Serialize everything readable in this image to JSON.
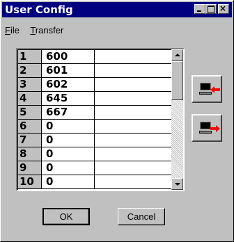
{
  "window": {
    "title": "User Config"
  },
  "menu": [
    {
      "label": "File",
      "underline": "F",
      "rest": "ile"
    },
    {
      "label": "Transfer",
      "underline": "T",
      "rest": "ransfer"
    }
  ],
  "table": {
    "rows": [
      {
        "index": "1",
        "value": "600"
      },
      {
        "index": "2",
        "value": "601"
      },
      {
        "index": "3",
        "value": "602"
      },
      {
        "index": "4",
        "value": "645"
      },
      {
        "index": "5",
        "value": "667"
      },
      {
        "index": "6",
        "value": "0"
      },
      {
        "index": "7",
        "value": "0"
      },
      {
        "index": "8",
        "value": "0"
      },
      {
        "index": "9",
        "value": "0"
      },
      {
        "index": "10",
        "value": "0"
      }
    ]
  },
  "side_buttons": [
    {
      "name": "upload-button",
      "icon": "computer-left-arrow-icon"
    },
    {
      "name": "download-button",
      "icon": "computer-right-arrow-icon"
    }
  ],
  "buttons": {
    "ok": "OK",
    "cancel": "Cancel"
  },
  "colors": {
    "titlebar": "#000080",
    "arrow": "#ff0000"
  }
}
